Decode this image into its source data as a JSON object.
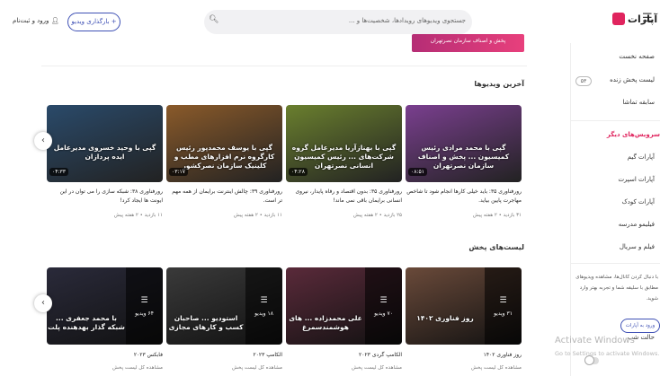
{
  "header": {
    "logo_text": "آپارات",
    "search_placeholder": "جستجوی ویدیوهای رویدادها، شخصیت‌ها و ...",
    "upload_label": "+ بارگذاری ویدیو",
    "login_label": "ورود و ثبت‌نام"
  },
  "sidebar": {
    "items": [
      "صفحه نخست",
      "لیست پخش زنده",
      "سابقه تماشا"
    ],
    "live_count": "۵۳",
    "other_heading": "سرویس‌های دیگر",
    "other_items": [
      "آپارات گیم",
      "آپارات اسپرت",
      "آپارات کودک",
      "فیلیمو مدرسه",
      "فیلم و سریال"
    ],
    "desc": "با دنبال کردن کانال‌ها، مشاهده ویدیوهای مطابق با سلیقه شما و تجربه بهتر وارد شوید.",
    "login_button": "ورود به آپارات",
    "dark_mode": "حالت شب"
  },
  "top_banner": "پخش و اصناف سازمان نصرتهران",
  "sections": {
    "latest_title": "آخرین ویدیوها",
    "playlists_title": "لیست‌های پخش"
  },
  "latest_videos": [
    {
      "caption": "گپی با محمد مرادی رئیس کمیسیون ... پخش و اصناف سازمان نصرتهران",
      "duration": "۰۸:۵۱",
      "title": "رورفناوری ۳۵: باید خیلی کارها انجام شود تا شاخص مهاجرت پایین بیاید.",
      "views": "۳۱ بازدید",
      "age": "۲ هفته پیش",
      "color": "#7a3f8f"
    },
    {
      "caption": "گپی با بهنازآریا مدیرعامل گروه شرکت‌های ... رئیس کمیسیون انسانی نصرتهران",
      "duration": "۰۴:۲۸",
      "title": "رورفناوری ۳۵: بدون اقتصاد و رفاه پایدار، نیروی انسانی برایمان باقی نمی ماند!",
      "views": "۲۵ بازدید",
      "age": "۲ هفته پیش",
      "color": "#6a7f2e"
    },
    {
      "caption": "گپی با یوسف محمدپور رئیس کارگروه نرم افزارهای مطب و کلینیک سازمان نصرکشور",
      "duration": "۰۳:۱۷",
      "title": "رورفناوری ۳۹: چالش اینترنت برایمان از همه مهم تر است.",
      "views": "۱۱ بازدید",
      "age": "۲ هفته پیش",
      "color": "#8a5a2a"
    },
    {
      "caption": "گپی با وحید خسروی مدیرعامل ایده پردازان",
      "duration": "۰۴:۳۳",
      "title": "رورفناوری ۳۸: شبکه سازی را می توان در این ایونت ها ایجاد کرد!",
      "views": "۱۱ بازدید",
      "age": "۲ هفته پیش",
      "color": "#2a4a6a"
    }
  ],
  "playlists": [
    {
      "caption": "روز فناوری ۱۴۰۲",
      "count": "۳۱ ویدیو",
      "title": "روز فناوری ۱۴۰۲",
      "link": "مشاهده کل لیست پخش",
      "color": "#6a4a3a"
    },
    {
      "caption": "علی محمدزاده ... های هوشمندسمرغ",
      "count": "۷۰ ویدیو",
      "title": "الکامپ گردی ۲۰۲۳",
      "link": "مشاهده کل لیست پخش",
      "color": "#5a2a3a"
    },
    {
      "caption": "استودیو ... صاحبان کسب و کارهای مجازی",
      "count": "۱۸ ویدیو",
      "title": "الکامپ ۲۰۲۳",
      "link": "مشاهده کل لیست پخش",
      "color": "#3a3a3a"
    },
    {
      "caption": "با محمد جعفری ... شبکه گذار بهدهنده پلت",
      "count": "۶۴ ویدیو",
      "title": "فابکس ۲۰۲۳",
      "link": "مشاهده کل لیست پخش",
      "color": "#2a2a3a"
    }
  ],
  "os_watermark": {
    "line1": "Activate Windows",
    "line2": "Go to Settings to activate Windows."
  }
}
